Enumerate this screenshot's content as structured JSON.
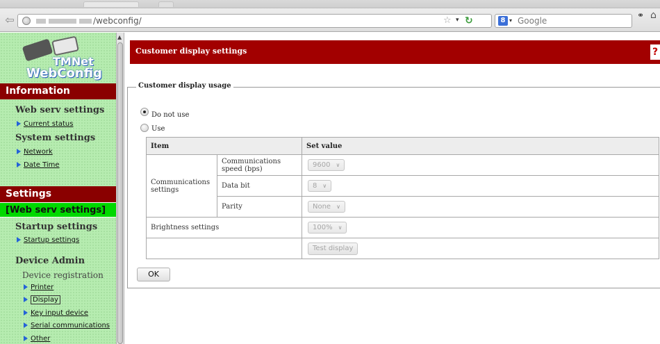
{
  "browser": {
    "url_text": "/webconfig/",
    "search_placeholder": "Google",
    "search_engine_letter": "8"
  },
  "sidebar": {
    "logo_line1": "TMNet",
    "logo_line2": "WebConfig",
    "information_header": "Information",
    "web_serv_title": "Web serv settings",
    "current_status": "Current status",
    "system_title": "System settings",
    "network": "Network",
    "date_time": "Date Time",
    "settings_header": "Settings",
    "web_serv_sub": "[Web serv settings]",
    "startup_title": "Startup settings",
    "startup_link": "Startup settings",
    "device_admin_title": "Device Admin",
    "device_registration": "Device registration",
    "links": {
      "printer": "Printer",
      "display": "Display",
      "key_input": "Key input device",
      "serial": "Serial communications",
      "other": "Other"
    }
  },
  "main": {
    "header_title": "Customer display settings",
    "help_label": "?",
    "fieldset_legend": "Customer display usage",
    "radio_do_not_use": "Do not use",
    "radio_use": "Use",
    "selected_usage": "Do not use",
    "table": {
      "col_item": "Item",
      "col_value": "Set value",
      "comm_group": "Communications settings",
      "comm_speed_label": "Communications speed (bps)",
      "comm_speed_value": "9600",
      "data_bit_label": "Data bit",
      "data_bit_value": "8",
      "parity_label": "Parity",
      "parity_value": "None",
      "brightness_label": "Brightness settings",
      "brightness_value": "100%",
      "test_display_label": "Test display"
    },
    "ok_label": "OK"
  },
  "colors": {
    "header_red": "#a20000",
    "sidebar_header_red": "#8a0000",
    "sidebar_green": "#b6ecb0",
    "sidebar_selected_green": "#00d800",
    "link_arrow_blue": "#2462d8"
  },
  "icons": {
    "back": "back-arrow-icon",
    "site": "globe-icon",
    "bookmark": "star-icon",
    "reload": "reload-icon",
    "search_engine": "search-engine-icon",
    "binoculars": "binoculars-icon",
    "home": "home-icon",
    "help": "help-icon"
  }
}
